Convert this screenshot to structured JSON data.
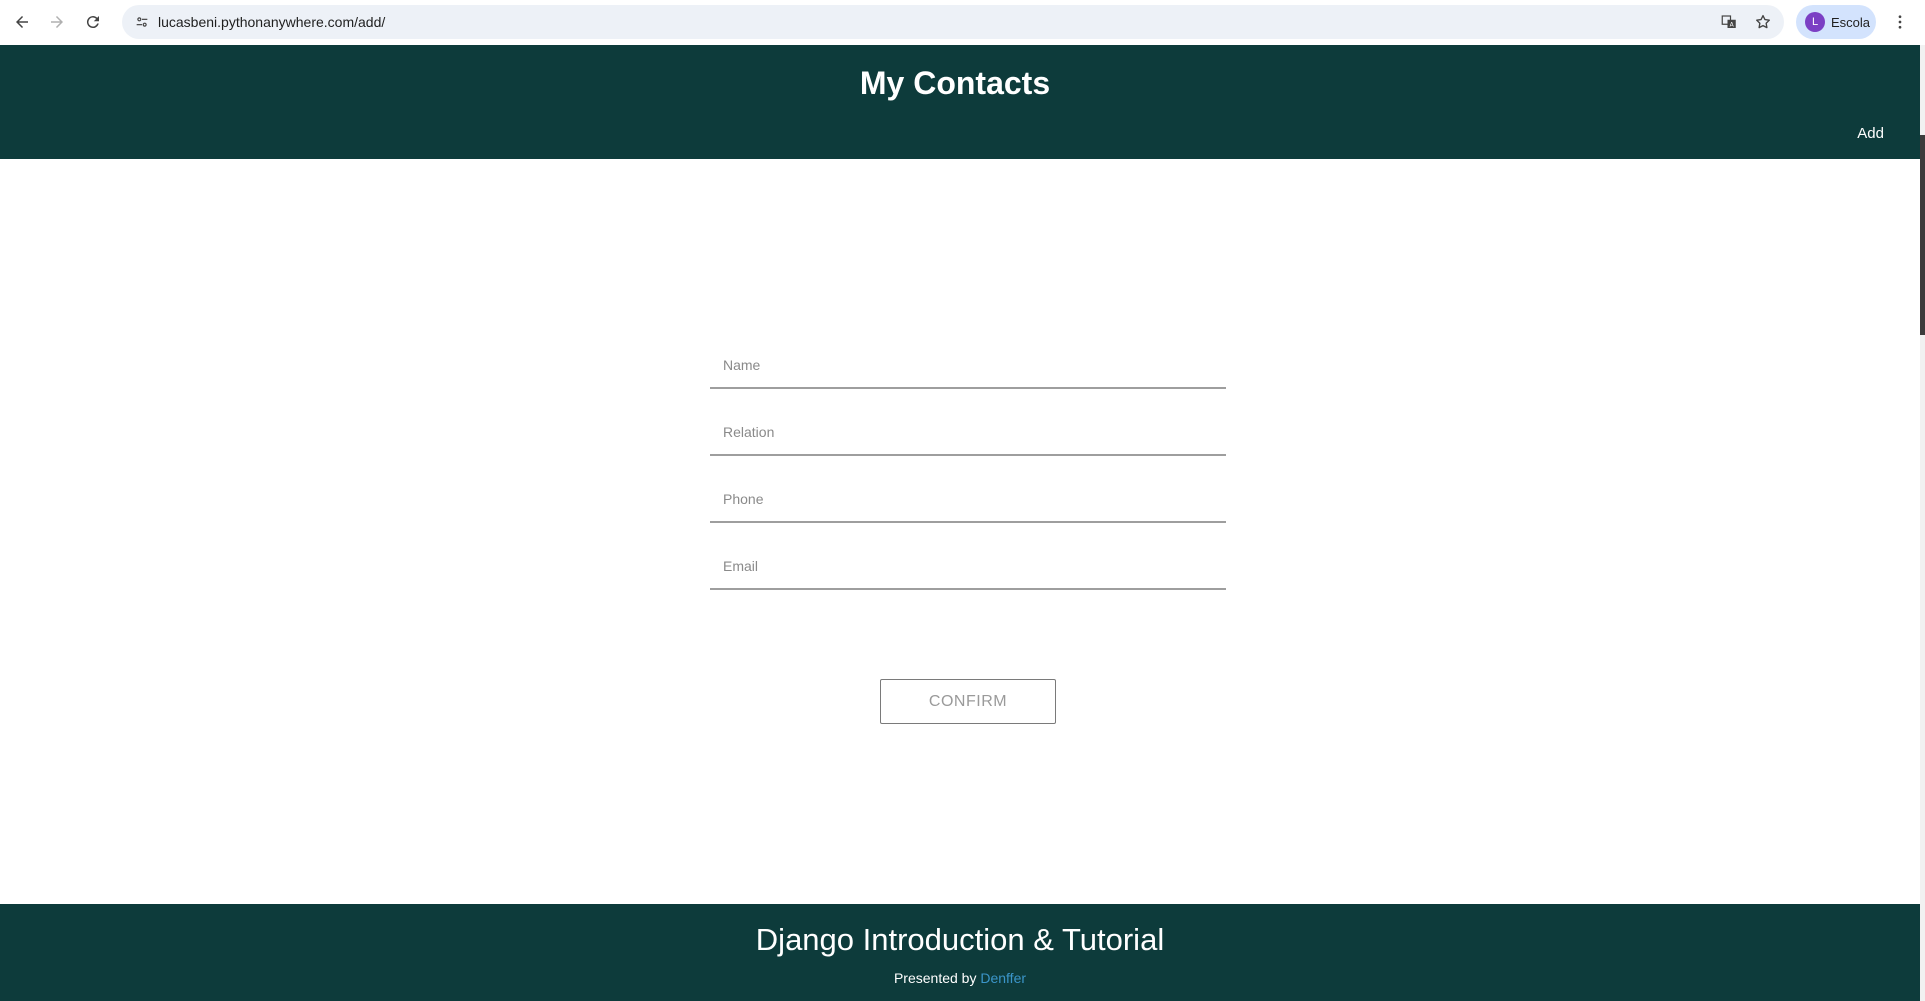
{
  "browser": {
    "url": "lucasbeni.pythonanywhere.com/add/",
    "profile_initial": "L",
    "profile_name": "Escola"
  },
  "header": {
    "title": "My Contacts",
    "add_label": "Add"
  },
  "form": {
    "name_placeholder": "Name",
    "relation_placeholder": "Relation",
    "phone_placeholder": "Phone",
    "email_placeholder": "Email",
    "confirm_label": "CONFIRM"
  },
  "footer": {
    "title": "Django Introduction & Tutorial",
    "presented_by": "Presented by",
    "author": "Denffer"
  },
  "colors": {
    "header_bg": "#0d3b3b",
    "link": "#3b95c9"
  }
}
